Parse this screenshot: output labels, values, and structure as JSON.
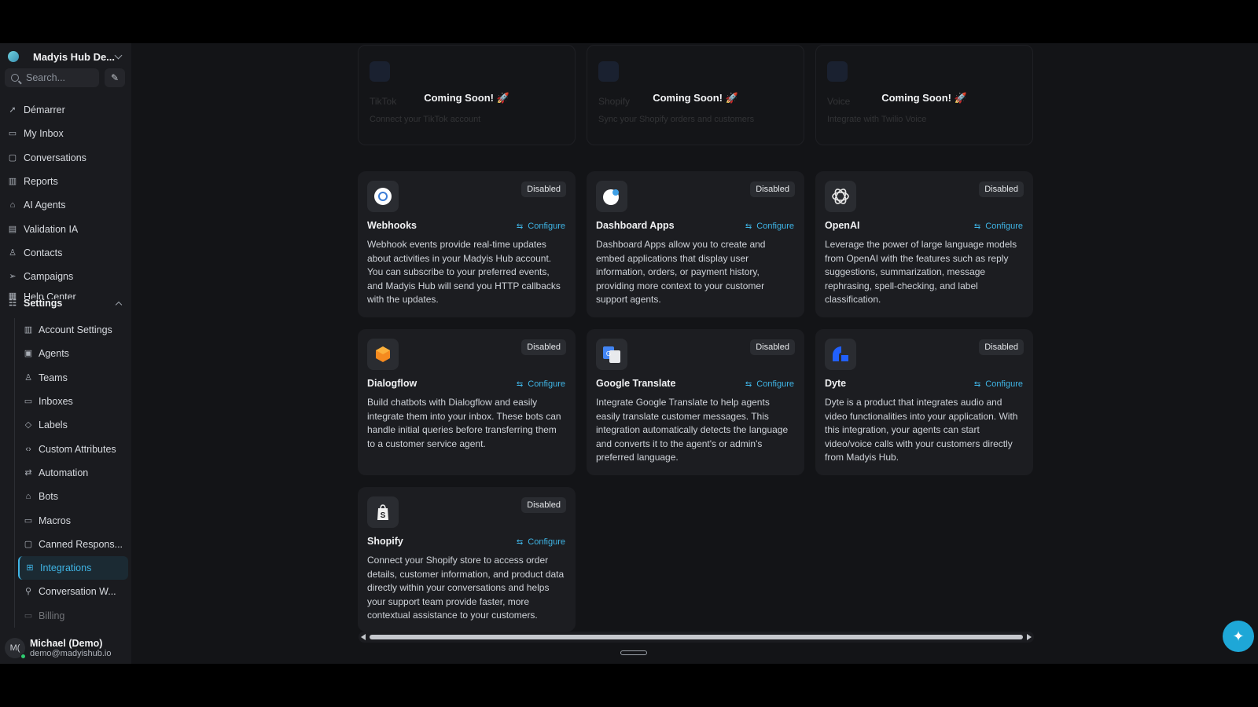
{
  "workspace": {
    "name": "Madyis Hub De..."
  },
  "search": {
    "placeholder": "Search..."
  },
  "nav": [
    {
      "label": "Démarrer",
      "icon": "rocket-icon"
    },
    {
      "label": "My Inbox",
      "icon": "inbox-icon"
    },
    {
      "label": "Conversations",
      "icon": "chat-icon"
    },
    {
      "label": "Reports",
      "icon": "chart-icon"
    },
    {
      "label": "AI Agents",
      "icon": "bot-icon"
    },
    {
      "label": "Validation IA",
      "icon": "clipboard-icon"
    },
    {
      "label": "Contacts",
      "icon": "person-icon"
    },
    {
      "label": "Campaigns",
      "icon": "send-icon"
    },
    {
      "label": "Help Center",
      "icon": "book-icon"
    }
  ],
  "settings": {
    "label": "Settings",
    "items": [
      {
        "label": "Account Settings"
      },
      {
        "label": "Agents"
      },
      {
        "label": "Teams"
      },
      {
        "label": "Inboxes"
      },
      {
        "label": "Labels"
      },
      {
        "label": "Custom Attributes"
      },
      {
        "label": "Automation"
      },
      {
        "label": "Bots"
      },
      {
        "label": "Macros"
      },
      {
        "label": "Canned Respons..."
      },
      {
        "label": "Integrations"
      },
      {
        "label": "Conversation W..."
      },
      {
        "label": "Billing"
      }
    ]
  },
  "user": {
    "name": "Michael (Demo)",
    "email": "demo@madyishub.io",
    "initials": "M("
  },
  "coming_soon": [
    {
      "label": "Coming Soon! 🚀",
      "ghost_title": "TikTok",
      "ghost_desc": "Connect your TikTok account"
    },
    {
      "label": "Coming Soon! 🚀",
      "ghost_title": "Shopify",
      "ghost_desc": "Sync your Shopify orders and customers"
    },
    {
      "label": "Coming Soon! 🚀",
      "ghost_title": "Voice",
      "ghost_desc": "Integrate with Twilio Voice"
    }
  ],
  "integrations": [
    {
      "title": "Webhooks",
      "status": "Disabled",
      "action": "Configure",
      "icon": "webhook-icon",
      "desc": "Webhook events provide real-time updates about activities in your Madyis Hub account. You can subscribe to your preferred events, and Madyis Hub will send you HTTP callbacks with the updates."
    },
    {
      "title": "Dashboard Apps",
      "status": "Disabled",
      "action": "Configure",
      "icon": "dashboard-apps-icon",
      "desc": "Dashboard Apps allow you to create and embed applications that display user information, orders, or payment history, providing more context to your customer support agents."
    },
    {
      "title": "OpenAI",
      "status": "Disabled",
      "action": "Configure",
      "icon": "openai-icon",
      "desc": "Leverage the power of large language models from OpenAI with the features such as reply suggestions, summarization, message rephrasing, spell-checking, and label classification."
    },
    {
      "title": "Dialogflow",
      "status": "Disabled",
      "action": "Configure",
      "icon": "dialogflow-icon",
      "desc": "Build chatbots with Dialogflow and easily integrate them into your inbox. These bots can handle initial queries before transferring them to a customer service agent."
    },
    {
      "title": "Google Translate",
      "status": "Disabled",
      "action": "Configure",
      "icon": "google-translate-icon",
      "desc": "Integrate Google Translate to help agents easily translate customer messages. This integration automatically detects the language and converts it to the agent's or admin's preferred language."
    },
    {
      "title": "Dyte",
      "status": "Disabled",
      "action": "Configure",
      "icon": "dyte-icon",
      "desc": "Dyte is a product that integrates audio and video functionalities into your application. With this integration, your agents can start video/voice calls with your customers directly from Madyis Hub."
    },
    {
      "title": "Shopify",
      "status": "Disabled",
      "action": "Configure",
      "icon": "shopify-icon",
      "desc": "Connect your Shopify store to access order details, customer information, and product data directly within your conversations and helps your support team provide faster, more contextual assistance to your customers."
    }
  ],
  "colors": {
    "accent": "#3fb5e6",
    "background": "#131417",
    "card": "#1c1d21"
  }
}
